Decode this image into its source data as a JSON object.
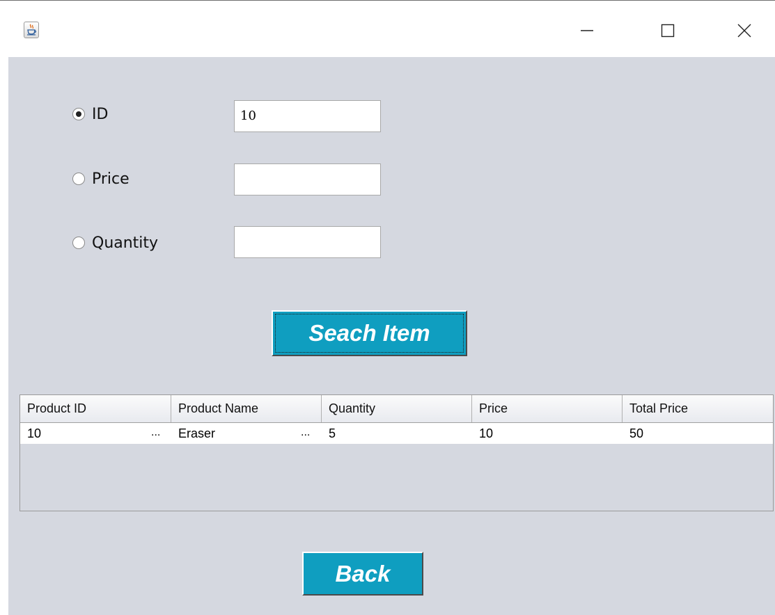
{
  "window": {
    "app_icon": "java-cup-icon",
    "minimize_icon": "minimize-icon",
    "maximize_icon": "maximize-icon",
    "close_icon": "close-icon"
  },
  "search_options": [
    {
      "label": "ID",
      "value": "10",
      "selected": true
    },
    {
      "label": "Price",
      "value": "",
      "selected": false
    },
    {
      "label": "Quantity",
      "value": "",
      "selected": false
    }
  ],
  "search_button": {
    "label": "Seach Item"
  },
  "results_table": {
    "columns": [
      "Product ID",
      "Product Name",
      "Quantity",
      "Price",
      "Total Price"
    ],
    "rows": [
      {
        "product_id": "10",
        "product_name": "Eraser",
        "quantity": "5",
        "price": "10",
        "total_price": "50",
        "truncated_marker": "..."
      }
    ]
  },
  "back_button": {
    "label": "Back"
  },
  "colors": {
    "button_bg": "#0f9ec0",
    "panel_bg": "#d5d8e0",
    "button_text": "#ffffff"
  }
}
